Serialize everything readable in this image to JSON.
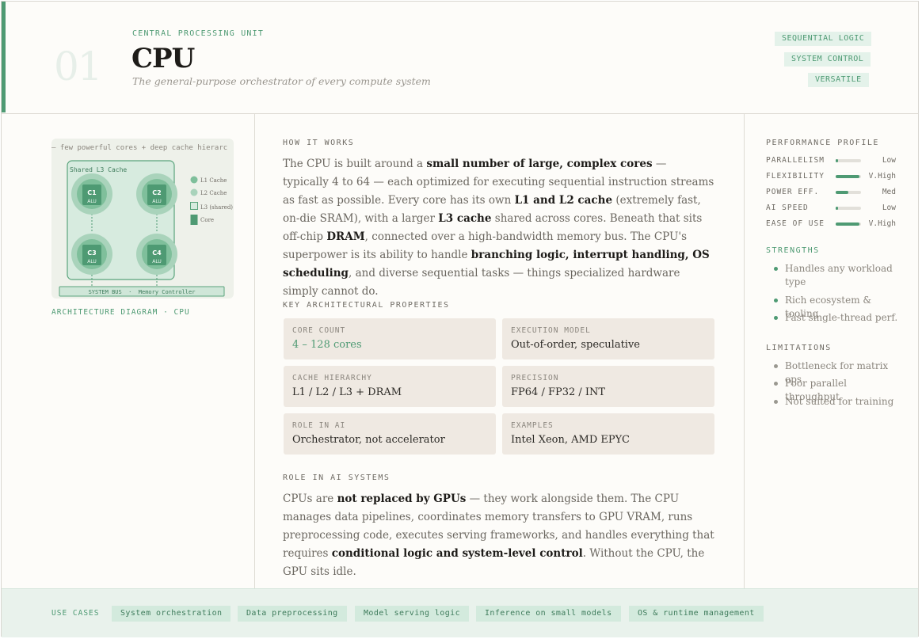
{
  "header": {
    "number": "01",
    "eyebrow": "CENTRAL PROCESSING UNIT",
    "title": "CPU",
    "subtitle": "The general-purpose orchestrator of every compute system",
    "tags": [
      "SEQUENTIAL LOGIC",
      "SYSTEM CONTROL",
      "VERSATILE"
    ]
  },
  "diagram": {
    "top_text": "— few powerful cores + deep cache hierarc",
    "l3_label": "Shared L3 Cache",
    "cores": [
      {
        "name": "C1",
        "unit": "ALU"
      },
      {
        "name": "C2",
        "unit": "ALU"
      },
      {
        "name": "C3",
        "unit": "ALU"
      },
      {
        "name": "C4",
        "unit": "ALU"
      }
    ],
    "legend": [
      "L1 Cache",
      "L2 Cache",
      "L3 (shared)",
      "Core"
    ],
    "bus_label": "SYSTEM BUS  ·  Memory Controller",
    "caption": "ARCHITECTURE DIAGRAM · CPU"
  },
  "how_it_works": {
    "heading": "HOW IT WORKS",
    "segments": [
      {
        "t": "The CPU is built around a "
      },
      {
        "t": "small number of large, complex cores",
        "b": true
      },
      {
        "t": " — typically 4 to 64 — each optimized for executing sequential instruction streams as fast as possible. Every core has its own "
      },
      {
        "t": "L1 and L2 cache",
        "b": true
      },
      {
        "t": " (extremely fast, on-die SRAM), with a larger "
      },
      {
        "t": "L3 cache",
        "b": true
      },
      {
        "t": " shared across cores. Beneath that sits off-chip "
      },
      {
        "t": "DRAM",
        "b": true
      },
      {
        "t": ", connected over a high-bandwidth memory bus. The CPU's superpower is its ability to handle "
      },
      {
        "t": "branching logic, interrupt handling, OS scheduling",
        "b": true
      },
      {
        "t": ", and diverse sequential tasks — things specialized hardware simply cannot do."
      }
    ]
  },
  "properties": {
    "heading": "KEY ARCHITECTURAL PROPERTIES",
    "items": [
      {
        "key": "CORE COUNT",
        "value": "4 – 128 cores",
        "accent": true
      },
      {
        "key": "EXECUTION MODEL",
        "value": "Out-of-order, speculative"
      },
      {
        "key": "CACHE HIERARCHY",
        "value": "L1 / L2 / L3 + DRAM"
      },
      {
        "key": "PRECISION",
        "value": "FP64 / FP32 / INT"
      },
      {
        "key": "ROLE IN AI",
        "value": "Orchestrator, not accelerator"
      },
      {
        "key": "EXAMPLES",
        "value": "Intel Xeon, AMD EPYC"
      }
    ]
  },
  "role": {
    "heading": "ROLE IN AI SYSTEMS",
    "segments": [
      {
        "t": "CPUs are "
      },
      {
        "t": "not replaced by GPUs",
        "b": true
      },
      {
        "t": " — they work alongside them. The CPU manages data pipelines, coordinates memory transfers to GPU VRAM, runs preprocessing code, executes serving frameworks, and handles everything that requires "
      },
      {
        "t": "conditional logic and system-level control",
        "b": true
      },
      {
        "t": ". Without the CPU, the GPU sits idle."
      }
    ]
  },
  "performance": {
    "heading": "PERFORMANCE PROFILE",
    "rows": [
      {
        "name": "PARALLELISM",
        "level": "Low",
        "fraction": 0.08
      },
      {
        "name": "FLEXIBILITY",
        "level": "V.High",
        "fraction": 0.95
      },
      {
        "name": "POWER EFF.",
        "level": "Med",
        "fraction": 0.5
      },
      {
        "name": "AI SPEED",
        "level": "Low",
        "fraction": 0.08
      },
      {
        "name": "EASE OF USE",
        "level": "V.High",
        "fraction": 0.95
      }
    ]
  },
  "strengths": {
    "heading": "STRENGTHS",
    "items": [
      "Handles any workload type",
      "Rich ecosystem & tooling",
      "Fast single-thread perf."
    ]
  },
  "limitations": {
    "heading": "LIMITATIONS",
    "items": [
      "Bottleneck for matrix ops",
      "Poor parallel throughput",
      "Not suited for training"
    ]
  },
  "use_cases": {
    "label": "USE CASES",
    "items": [
      "System orchestration",
      "Data preprocessing",
      "Model serving logic",
      "Inference on small models",
      "OS & runtime management"
    ]
  },
  "colors": {
    "accent": "#4e9a73",
    "card": "#efe9e2",
    "footer": "#e9f2ec",
    "muted": "#9a9890"
  }
}
